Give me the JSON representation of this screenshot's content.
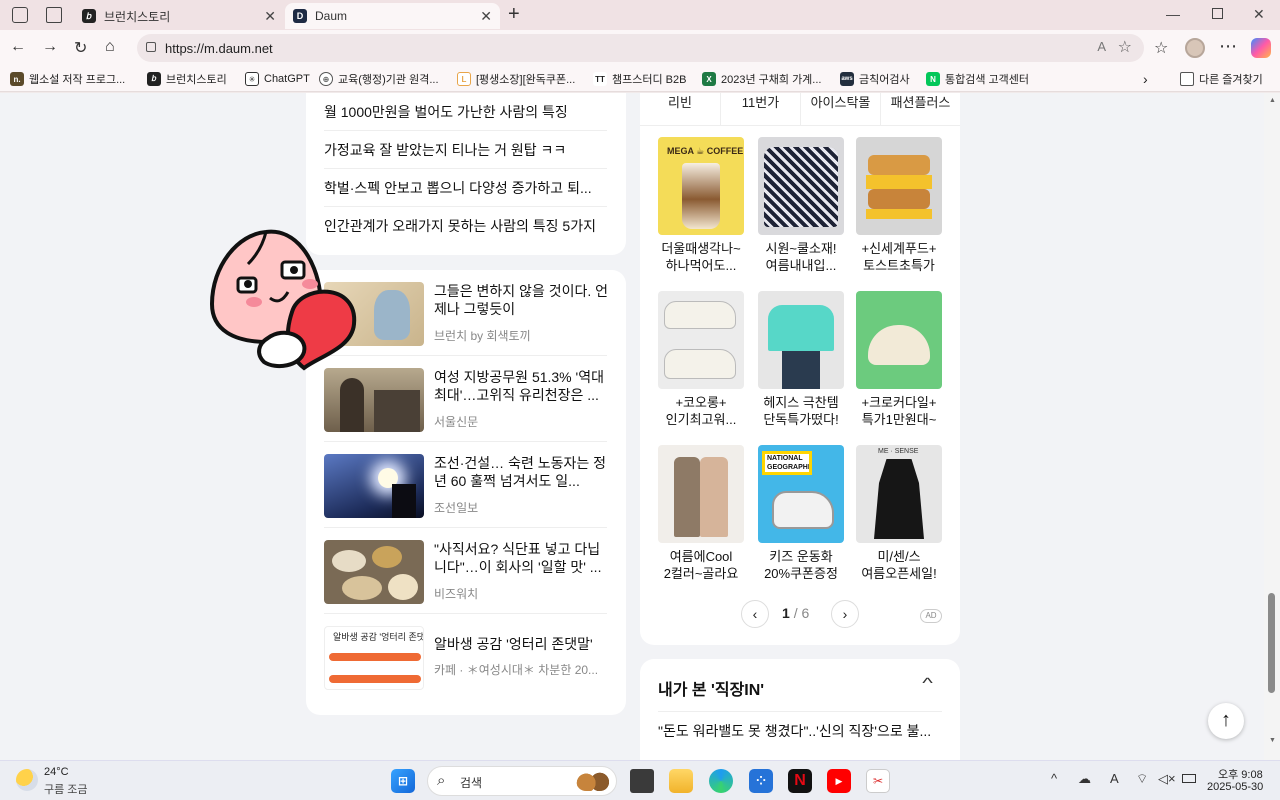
{
  "browser": {
    "tabs": [
      {
        "label": "브런치스토리",
        "active": false
      },
      {
        "label": "Daum",
        "active": true
      }
    ],
    "url": "https://m.daum.net",
    "bookmarks": [
      "웹소설 저작 프로그...",
      "브런치스토리",
      "ChatGPT",
      "교육(행정)기관 원격...",
      "[평생소장][완독쿠폰...",
      "챔프스터디 B2B",
      "2023년 구채희 가계...",
      "금칙어검사",
      "통합검색 고객센터"
    ],
    "other_bookmarks": "다른 즐겨찾기"
  },
  "left_column": {
    "headlines": [
      "월 1000만원을 벌어도 가난한 사람의 특징",
      "가정교육 잘 받았는지 티나는 거 원탑 ㅋㅋ",
      "학벌·스펙 안보고 뽑으니 다양성 증가하고 퇴...",
      "인간관계가 오래가지 못하는 사람의 특징 5가지"
    ],
    "articles": [
      {
        "title": "그들은 변하지 않을 것이다. 언제나 그렇듯이",
        "source": "브런치 by 회색토끼"
      },
      {
        "title": "여성 지방공무원 51.3% '역대 최대'…고위직 유리천장은 ...",
        "source": "서울신문"
      },
      {
        "title": "조선·건설… 숙련 노동자는 정년 60 훌쩍 넘겨서도 일...",
        "source": "조선일보"
      },
      {
        "title": "\"사직서요? 식단표 넣고 다닙니다\"…이 회사의 '일할 맛' ...",
        "source": "비즈워치"
      },
      {
        "title": "알바생 공감 '엉터리 존댓말'",
        "source": "카페 · ＊여성시대＊ 차분한 20..."
      }
    ],
    "thumb_caption": "알바생 공감 '엉터리 존댓말'"
  },
  "shopping": {
    "tabs": [
      "리빈",
      "11번가",
      "아이스탁몰",
      "패션플러스"
    ],
    "products": [
      {
        "l1": "더울때생각나~",
        "l2": "하나먹어도..."
      },
      {
        "l1": "시원~쿨소재!",
        "l2": "여름내내입..."
      },
      {
        "l1": "+신세계푸드+",
        "l2": "토스트초특가"
      },
      {
        "l1": "+코오롱+",
        "l2": "인기최고워..."
      },
      {
        "l1": "헤지스 극찬템",
        "l2": "단독특가떴다!"
      },
      {
        "l1": "+크로커다일+",
        "l2": "특가1만원대~"
      },
      {
        "l1": "여름에Cool",
        "l2": "2컬러~골라요"
      },
      {
        "l1": "키즈 운동화",
        "l2": "20%쿠폰증정"
      },
      {
        "l1": "미/센/스",
        "l2": "여름오픈세일!"
      }
    ],
    "image_labels": {
      "mega": "MEGA ☕ COFFEE",
      "geo": "NATIONAL GEOGRAPHIC",
      "mesense": "ME · SENSE"
    },
    "page_current": "1",
    "page_total": "/ 6",
    "ad": "AD"
  },
  "recent_section": {
    "title": "내가 본 '직장IN'",
    "item": "\"돈도 워라밸도 못 챙겼다\"..'신의 직장'으로 불..."
  },
  "taskbar": {
    "weather_temp": "24°C",
    "weather_desc": "구름 조금",
    "search_placeholder": "검색",
    "time": "오후 9:08",
    "date": "2025-05-30",
    "lang": "A"
  }
}
